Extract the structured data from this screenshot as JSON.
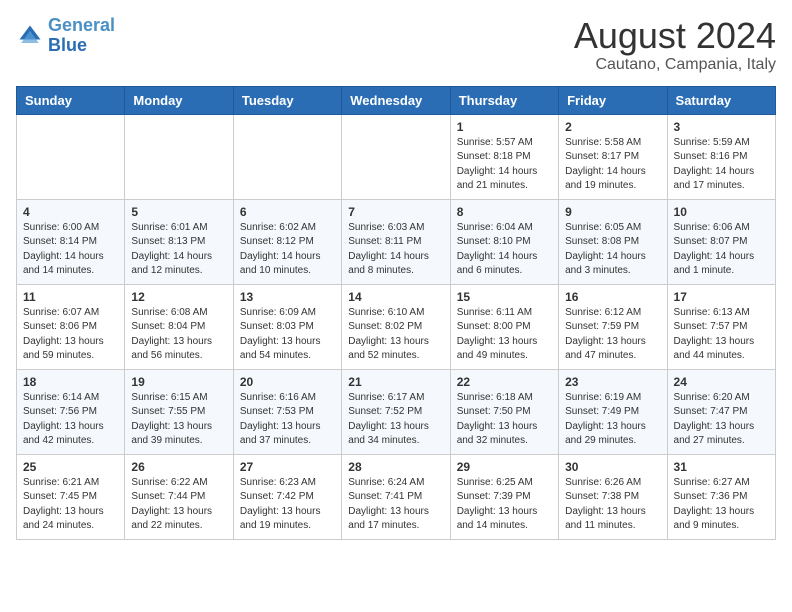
{
  "header": {
    "logo_line1": "General",
    "logo_line2": "Blue",
    "month_year": "August 2024",
    "location": "Cautano, Campania, Italy"
  },
  "weekdays": [
    "Sunday",
    "Monday",
    "Tuesday",
    "Wednesday",
    "Thursday",
    "Friday",
    "Saturday"
  ],
  "weeks": [
    [
      {
        "day": "",
        "info": ""
      },
      {
        "day": "",
        "info": ""
      },
      {
        "day": "",
        "info": ""
      },
      {
        "day": "",
        "info": ""
      },
      {
        "day": "1",
        "info": "Sunrise: 5:57 AM\nSunset: 8:18 PM\nDaylight: 14 hours\nand 21 minutes."
      },
      {
        "day": "2",
        "info": "Sunrise: 5:58 AM\nSunset: 8:17 PM\nDaylight: 14 hours\nand 19 minutes."
      },
      {
        "day": "3",
        "info": "Sunrise: 5:59 AM\nSunset: 8:16 PM\nDaylight: 14 hours\nand 17 minutes."
      }
    ],
    [
      {
        "day": "4",
        "info": "Sunrise: 6:00 AM\nSunset: 8:14 PM\nDaylight: 14 hours\nand 14 minutes."
      },
      {
        "day": "5",
        "info": "Sunrise: 6:01 AM\nSunset: 8:13 PM\nDaylight: 14 hours\nand 12 minutes."
      },
      {
        "day": "6",
        "info": "Sunrise: 6:02 AM\nSunset: 8:12 PM\nDaylight: 14 hours\nand 10 minutes."
      },
      {
        "day": "7",
        "info": "Sunrise: 6:03 AM\nSunset: 8:11 PM\nDaylight: 14 hours\nand 8 minutes."
      },
      {
        "day": "8",
        "info": "Sunrise: 6:04 AM\nSunset: 8:10 PM\nDaylight: 14 hours\nand 6 minutes."
      },
      {
        "day": "9",
        "info": "Sunrise: 6:05 AM\nSunset: 8:08 PM\nDaylight: 14 hours\nand 3 minutes."
      },
      {
        "day": "10",
        "info": "Sunrise: 6:06 AM\nSunset: 8:07 PM\nDaylight: 14 hours\nand 1 minute."
      }
    ],
    [
      {
        "day": "11",
        "info": "Sunrise: 6:07 AM\nSunset: 8:06 PM\nDaylight: 13 hours\nand 59 minutes."
      },
      {
        "day": "12",
        "info": "Sunrise: 6:08 AM\nSunset: 8:04 PM\nDaylight: 13 hours\nand 56 minutes."
      },
      {
        "day": "13",
        "info": "Sunrise: 6:09 AM\nSunset: 8:03 PM\nDaylight: 13 hours\nand 54 minutes."
      },
      {
        "day": "14",
        "info": "Sunrise: 6:10 AM\nSunset: 8:02 PM\nDaylight: 13 hours\nand 52 minutes."
      },
      {
        "day": "15",
        "info": "Sunrise: 6:11 AM\nSunset: 8:00 PM\nDaylight: 13 hours\nand 49 minutes."
      },
      {
        "day": "16",
        "info": "Sunrise: 6:12 AM\nSunset: 7:59 PM\nDaylight: 13 hours\nand 47 minutes."
      },
      {
        "day": "17",
        "info": "Sunrise: 6:13 AM\nSunset: 7:57 PM\nDaylight: 13 hours\nand 44 minutes."
      }
    ],
    [
      {
        "day": "18",
        "info": "Sunrise: 6:14 AM\nSunset: 7:56 PM\nDaylight: 13 hours\nand 42 minutes."
      },
      {
        "day": "19",
        "info": "Sunrise: 6:15 AM\nSunset: 7:55 PM\nDaylight: 13 hours\nand 39 minutes."
      },
      {
        "day": "20",
        "info": "Sunrise: 6:16 AM\nSunset: 7:53 PM\nDaylight: 13 hours\nand 37 minutes."
      },
      {
        "day": "21",
        "info": "Sunrise: 6:17 AM\nSunset: 7:52 PM\nDaylight: 13 hours\nand 34 minutes."
      },
      {
        "day": "22",
        "info": "Sunrise: 6:18 AM\nSunset: 7:50 PM\nDaylight: 13 hours\nand 32 minutes."
      },
      {
        "day": "23",
        "info": "Sunrise: 6:19 AM\nSunset: 7:49 PM\nDaylight: 13 hours\nand 29 minutes."
      },
      {
        "day": "24",
        "info": "Sunrise: 6:20 AM\nSunset: 7:47 PM\nDaylight: 13 hours\nand 27 minutes."
      }
    ],
    [
      {
        "day": "25",
        "info": "Sunrise: 6:21 AM\nSunset: 7:45 PM\nDaylight: 13 hours\nand 24 minutes."
      },
      {
        "day": "26",
        "info": "Sunrise: 6:22 AM\nSunset: 7:44 PM\nDaylight: 13 hours\nand 22 minutes."
      },
      {
        "day": "27",
        "info": "Sunrise: 6:23 AM\nSunset: 7:42 PM\nDaylight: 13 hours\nand 19 minutes."
      },
      {
        "day": "28",
        "info": "Sunrise: 6:24 AM\nSunset: 7:41 PM\nDaylight: 13 hours\nand 17 minutes."
      },
      {
        "day": "29",
        "info": "Sunrise: 6:25 AM\nSunset: 7:39 PM\nDaylight: 13 hours\nand 14 minutes."
      },
      {
        "day": "30",
        "info": "Sunrise: 6:26 AM\nSunset: 7:38 PM\nDaylight: 13 hours\nand 11 minutes."
      },
      {
        "day": "31",
        "info": "Sunrise: 6:27 AM\nSunset: 7:36 PM\nDaylight: 13 hours\nand 9 minutes."
      }
    ]
  ]
}
